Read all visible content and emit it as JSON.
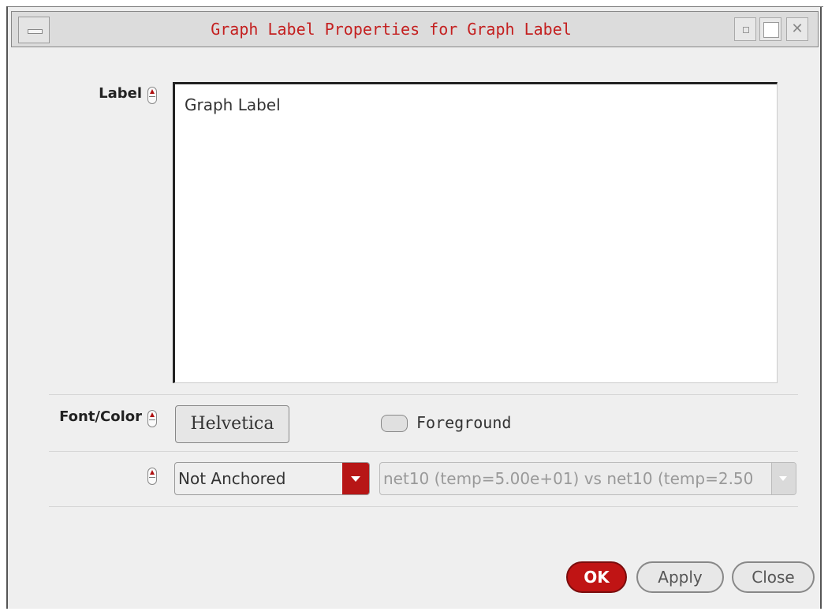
{
  "window": {
    "title": "Graph Label Properties for Graph Label"
  },
  "form": {
    "label_field": {
      "label": "Label",
      "value": "Graph Label"
    },
    "font_color": {
      "label": "Font/Color",
      "font_button": "Helvetica",
      "foreground_label": "Foreground",
      "foreground_checked": false
    },
    "anchor": {
      "selected": "Not Anchored",
      "target": "net10 (temp=5.00e+01) vs net10 (temp=2.50"
    }
  },
  "buttons": {
    "ok": "OK",
    "apply": "Apply",
    "close": "Close"
  },
  "colors": {
    "accent": "#b71616",
    "title_text": "#c42020",
    "dialog_bg": "#efefef"
  },
  "icons": [
    "window-menu-icon",
    "minimize-icon",
    "maximize-icon",
    "close-window-icon",
    "spinner-icon"
  ]
}
